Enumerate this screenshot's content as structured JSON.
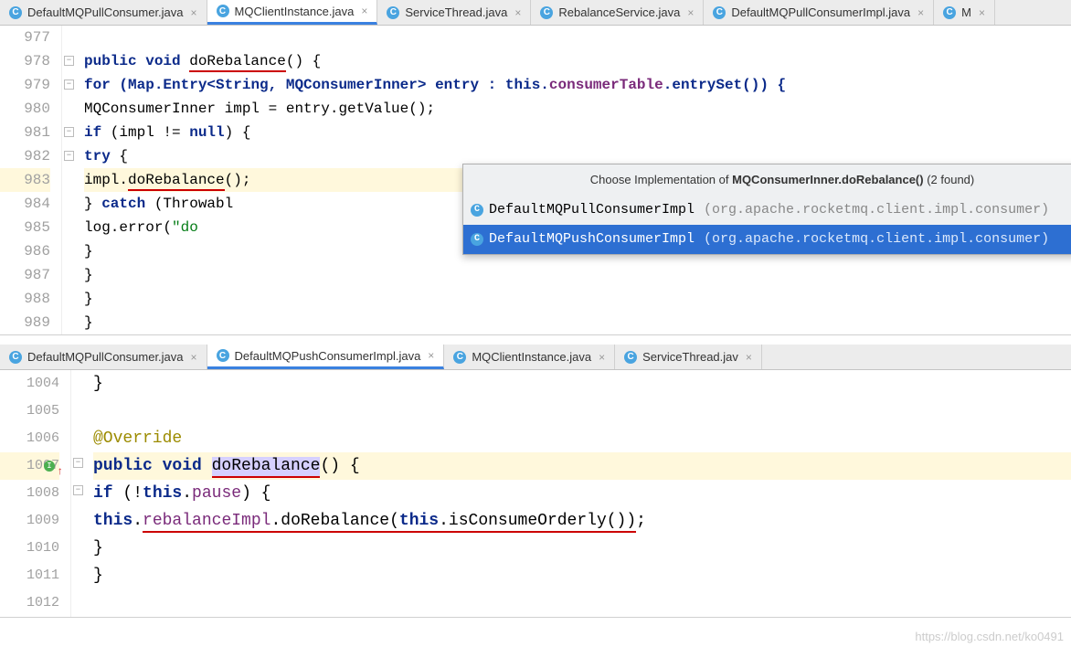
{
  "top_pane": {
    "tabs": [
      {
        "label": "DefaultMQPullConsumer.java",
        "active": false
      },
      {
        "label": "MQClientInstance.java",
        "active": true
      },
      {
        "label": "ServiceThread.java",
        "active": false
      },
      {
        "label": "RebalanceService.java",
        "active": false
      },
      {
        "label": "DefaultMQPullConsumerImpl.java",
        "active": false
      },
      {
        "label": "M",
        "active": false
      }
    ],
    "lines": {
      "l977": "",
      "l978_pre": "    public void ",
      "l978_mid": "doRebalance",
      "l978_post": "() {",
      "l979_a": "        for (Map.Entry<String, MQConsumerInner> entry : ",
      "l979_b": "this",
      "l979_c": ".",
      "l979_d": "consumerTable",
      "l979_e": ".entrySet()) {",
      "l980": "            MQConsumerInner impl = entry.getValue();",
      "l981_a": "            if (impl != ",
      "l981_b": "null",
      "l981_c": ") {",
      "l982_a": "                try {",
      "l983_a": "                    impl.",
      "l983_b": "doRebalance",
      "l983_c": "();",
      "l984_a": "                } ",
      "l984_b": "catch",
      "l984_c": " (Throwabl",
      "l985_a": "                    log.error(",
      "l985_b": "\"do",
      "l986": "                }",
      "l987": "            }",
      "l988": "        }",
      "l989": "    }"
    },
    "line_numbers": [
      "977",
      "978",
      "979",
      "980",
      "981",
      "982",
      "983",
      "984",
      "985",
      "986",
      "987",
      "988",
      "989"
    ],
    "highlighted_line": "983",
    "popup": {
      "title_pre": "Choose Implementation of ",
      "title_bold": "MQConsumerInner.doRebalance()",
      "title_post": " (2 found)",
      "items": [
        {
          "name": "DefaultMQPullConsumerImpl",
          "pkg": "(org.apache.rocketmq.client.impl.consumer)",
          "selected": false
        },
        {
          "name": "DefaultMQPushConsumerImpl",
          "pkg": "(org.apache.rocketmq.client.impl.consumer)",
          "selected": true
        }
      ]
    }
  },
  "bottom_pane": {
    "tabs": [
      {
        "label": "DefaultMQPullConsumer.java",
        "active": false
      },
      {
        "label": "DefaultMQPushConsumerImpl.java",
        "active": true
      },
      {
        "label": "MQClientInstance.java",
        "active": false
      },
      {
        "label": "ServiceThread.jav",
        "active": false
      }
    ],
    "line_numbers": [
      "1004",
      "1005",
      "1006",
      "1007",
      "1008",
      "1009",
      "1010",
      "1011",
      "1012"
    ],
    "highlighted_line": "1007",
    "lines": {
      "l1004": "        }",
      "l1005": "",
      "l1006": "    @Override",
      "l1007_a": "    public void ",
      "l1007_b": "doRebalance",
      "l1007_c": "() {",
      "l1008_a": "        if (!",
      "l1008_b": "this",
      "l1008_c": ".",
      "l1008_d": "pause",
      "l1008_e": ") {",
      "l1009_a": "            ",
      "l1009_b": "this",
      "l1009_c": ".",
      "l1009_d": "rebalanceImpl",
      "l1009_e": ".doRebalance(",
      "l1009_f": "this",
      "l1009_g": ".isConsumeOrderly()",
      "l1009_h": ");",
      "l1010": "        }",
      "l1011": "    }",
      "l1012": ""
    }
  },
  "watermark": "https://blog.csdn.net/ko0491"
}
